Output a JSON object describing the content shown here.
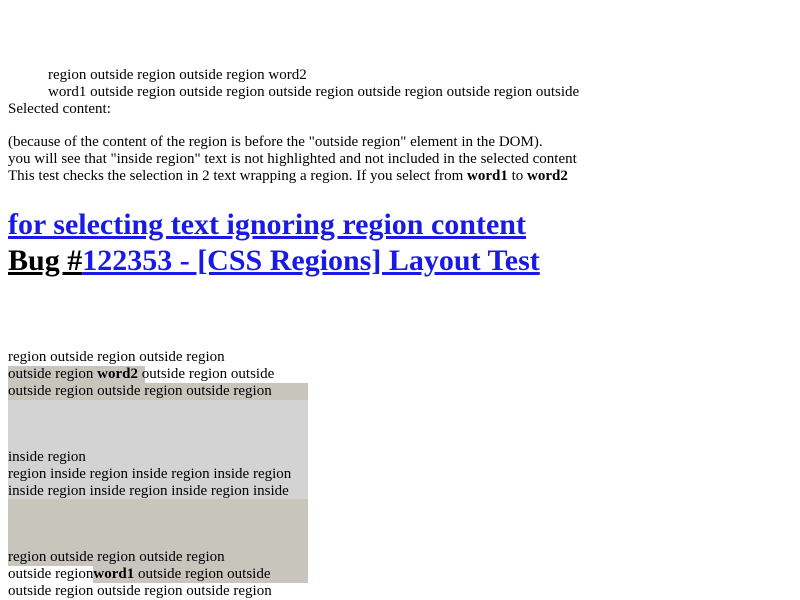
{
  "top_block": {
    "line1": "region outside region outside region word2",
    "line2": "word1 outside region outside region outside region outside region outside region outside",
    "selected_label": "Selected content:"
  },
  "description": {
    "line1": "(because of the content of the region is before the \"outside region\" element in the DOM).",
    "line2": "you will see that \"inside region\" text is not highlighted and not included in the selected content",
    "line3_prefix": "This test checks the selection in 2 text wrapping a region. If you select from ",
    "line3_word1": "word1",
    "line3_middle": " to ",
    "line3_word2": "word2"
  },
  "heading": {
    "line1": "for selecting text ignoring region content",
    "line2_prefix": "Bug #",
    "line2_link": "122353 - [CSS Regions] Layout Test"
  },
  "test_area": {
    "upper_outside": {
      "line1": "region outside region outside region",
      "line2_a": "outside region ",
      "line2_b": "word2",
      "line2_c": " outside region outside",
      "line3": "outside region outside region outside region"
    },
    "inside": {
      "line1": "inside region",
      "line2": "region inside region inside region inside region",
      "line3": "inside region inside region inside region inside"
    },
    "lower_outside": {
      "line1": "region outside region outside region",
      "line2_a": "outside region ",
      "line2_b": "word1",
      "line2_c": " outside region outside",
      "line3": "outside region outside region outside region"
    }
  }
}
